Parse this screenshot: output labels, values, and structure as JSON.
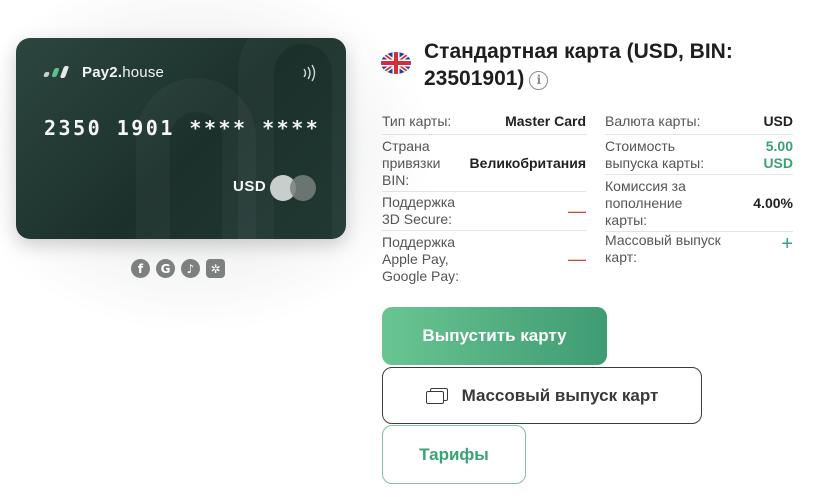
{
  "card": {
    "brand_name": "Pay2.",
    "brand_suffix": "house",
    "masked_number": "2350 1901 **** ****",
    "currency": "USD",
    "contactless_icon": "nfc-icon",
    "network_icon": "mastercard-logo"
  },
  "socials": [
    {
      "icon": "facebook-icon",
      "glyph": "f"
    },
    {
      "icon": "google-icon",
      "glyph": "G"
    },
    {
      "icon": "tiktok-icon",
      "glyph": "♪"
    },
    {
      "icon": "openai-icon",
      "glyph": "✲"
    }
  ],
  "header": {
    "flag_icon": "uk-flag-icon",
    "title": "Стандартная карта (USD, BIN: 23501901)",
    "info_icon": "info-icon"
  },
  "left_details": [
    {
      "label": "Тип карты:",
      "value": "Master Card"
    },
    {
      "label": "Страна привязки BIN:",
      "value": "Великобритания"
    },
    {
      "label": "Поддержка 3D Secure:",
      "value": "—"
    },
    {
      "label": "Поддержка Apple Pay, Google Pay:",
      "value": "—"
    }
  ],
  "right_details": [
    {
      "label": "Валюта карты:",
      "value": "USD"
    },
    {
      "label": "Стоимость выпуска карты:",
      "value": "5.00 USD"
    },
    {
      "label": "Комиссия за пополнение карты:",
      "value": "4.00%"
    },
    {
      "label": "Массовый выпуск карт:",
      "value": "+"
    }
  ],
  "actions": {
    "issue_label": "Выпустить карту",
    "bulk_label": "Массовый выпуск карт",
    "tariffs_label": "Тарифы"
  },
  "colors": {
    "accent_green": "#3aa374",
    "negative_red": "#d43d3d",
    "card_bg": "#22382f"
  }
}
